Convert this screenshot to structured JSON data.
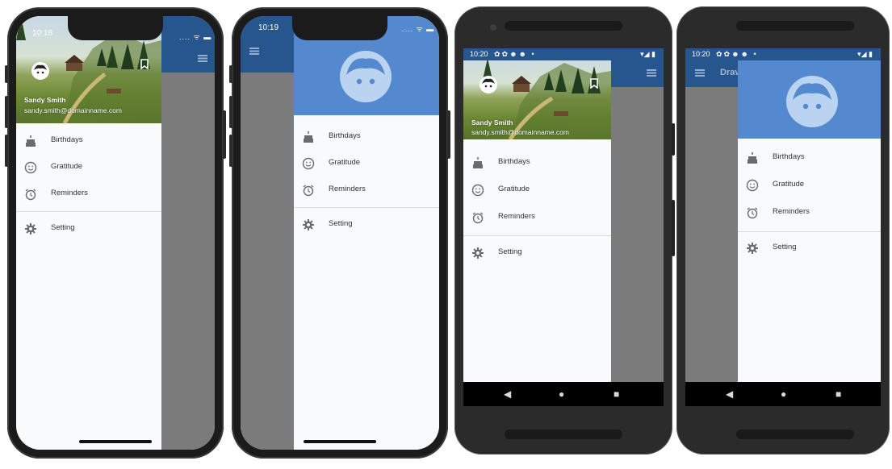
{
  "phones": [
    {
      "platform": "iOS",
      "time": "10:18",
      "header": "image",
      "user_name": "Sandy Smith",
      "user_email": "sandy.smith@domainname.com"
    },
    {
      "platform": "iOS",
      "time": "10:19",
      "header": "avatar"
    },
    {
      "platform": "Android",
      "time": "10:20",
      "header": "image",
      "user_name": "Sandy Smith",
      "user_email": "sandy.smith@domainname.com"
    },
    {
      "platform": "Android",
      "time": "10:20",
      "header": "avatar",
      "appbar_title": "Drav"
    }
  ],
  "menu": {
    "items": [
      {
        "label": "Birthdays",
        "icon": "cake-icon"
      },
      {
        "label": "Gratitude",
        "icon": "smiley-icon"
      },
      {
        "label": "Reminders",
        "icon": "alarm-icon"
      }
    ],
    "settings": {
      "label": "Setting",
      "icon": "gear-icon"
    }
  },
  "android_labels_clipped": [
    "Birthdays",
    "Gratitude",
    "Reminders",
    "Setting"
  ],
  "colors": {
    "appbar": "#3a6aa8",
    "drawer_header": "#5488cf",
    "avatar": "#b9d3f1",
    "scrim": "#7b7b7b"
  }
}
